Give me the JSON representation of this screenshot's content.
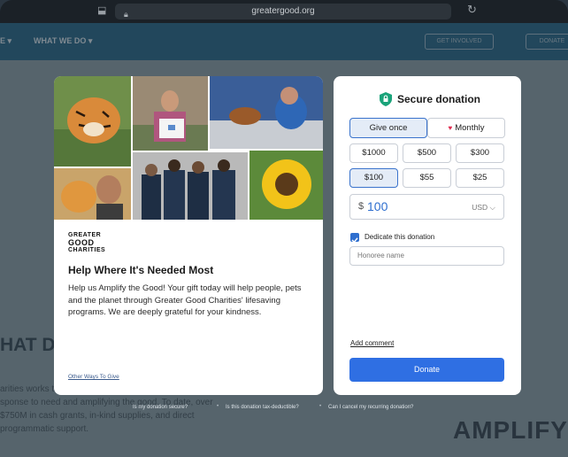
{
  "browser": {
    "url": "greatergood.org"
  },
  "site": {
    "nav_what_we_do": "WHAT WE DO ▾",
    "nav_left_stub": "E ▾",
    "nav_btn_1": "GET INVOLVED",
    "nav_btn_2": "DONATE",
    "bg_heading": "HAT DOES",
    "bg_paragraph": "arities works to help people, pets and the planet by sponse to need and amplifying the good. To date, over $750M in cash grants, in-kind supplies, and direct programmatic support.",
    "amplify": "AMPLIFY"
  },
  "left_card": {
    "logo_lines": [
      "GREATER",
      "GOOD",
      "CHARITIES"
    ],
    "title": "Help Where It's Needed Most",
    "text": "Help us Amplify the Good! Your gift today will help people, pets and the planet through Greater Good Charities' lifesaving programs. We are deeply grateful for your kindness.",
    "other_ways": "Other Ways To Give"
  },
  "donation": {
    "heading": "Secure donation",
    "frequency": {
      "once": "Give once",
      "monthly": "Monthly",
      "selected": "once"
    },
    "amounts": [
      "$1000",
      "$500",
      "$300",
      "$100",
      "$55",
      "$25"
    ],
    "selected_amount": "$100",
    "currency_symbol": "$",
    "amount_value": "100",
    "currency": "USD",
    "dedicate_label": "Dedicate this donation",
    "dedicate_checked": true,
    "honoree_placeholder": "Honoree name",
    "add_comment": "Add comment",
    "donate_button": "Donate"
  },
  "faq": {
    "q1": "Is my donation secure?",
    "q2": "Is this donation tax-deductible?",
    "q3": "Can I cancel my recurring donation?"
  },
  "colors": {
    "accent": "#2f6fe3",
    "selected_bg": "#e4ecf7",
    "secure_green": "#1aa37a",
    "heart": "#e02b4f"
  }
}
